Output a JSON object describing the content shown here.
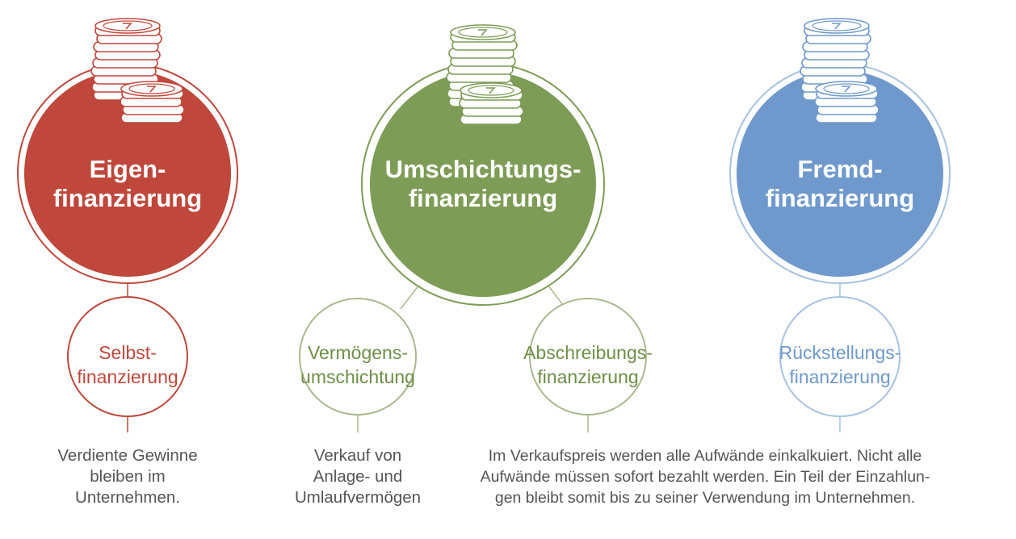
{
  "colors": {
    "eigen": "#bf473b",
    "umschichtung": "#7d9c56",
    "fremd": "#6f99cc",
    "umschichtung_light": "#a9b98e",
    "fremd_light": "#a7c2e2",
    "text_grey": "#555555"
  },
  "icons": [
    "coin-stack-icon"
  ],
  "categories": [
    {
      "key": "eigen",
      "title_lines": [
        "Eigen-",
        "finanzierung"
      ]
    },
    {
      "key": "umschichtung",
      "title_lines": [
        "Umschichtungs-",
        "finanzierung"
      ]
    },
    {
      "key": "fremd",
      "title_lines": [
        "Fremd-",
        "finanzierung"
      ]
    }
  ],
  "subtypes": [
    {
      "key": "selbst",
      "title_lines": [
        "Selbst-",
        "finanzierung"
      ]
    },
    {
      "key": "vermoegen",
      "title_lines": [
        "Vermögens-",
        "umschichtung"
      ]
    },
    {
      "key": "abschreibung",
      "title_lines": [
        "Abschreibungs-",
        "finanzierung"
      ]
    },
    {
      "key": "rueckstellung",
      "title_lines": [
        "Rückstellungs-",
        "finanzierung"
      ]
    }
  ],
  "descriptions": {
    "selbst": [
      "Verdiente Gewinne",
      "bleiben im",
      "Unternehmen."
    ],
    "vermoegen": [
      "Verkauf von",
      "Anlage- und",
      "Umlaufvermögen"
    ],
    "shared": [
      "Im Verkaufspreis werden alle Aufwände einkalkuiert. Nicht alle",
      "Aufwände müssen sofort bezahlt werden. Ein Teil der Einzahlun-",
      "gen bleibt somit bis zu seiner Verwendung im Unternehmen."
    ]
  }
}
